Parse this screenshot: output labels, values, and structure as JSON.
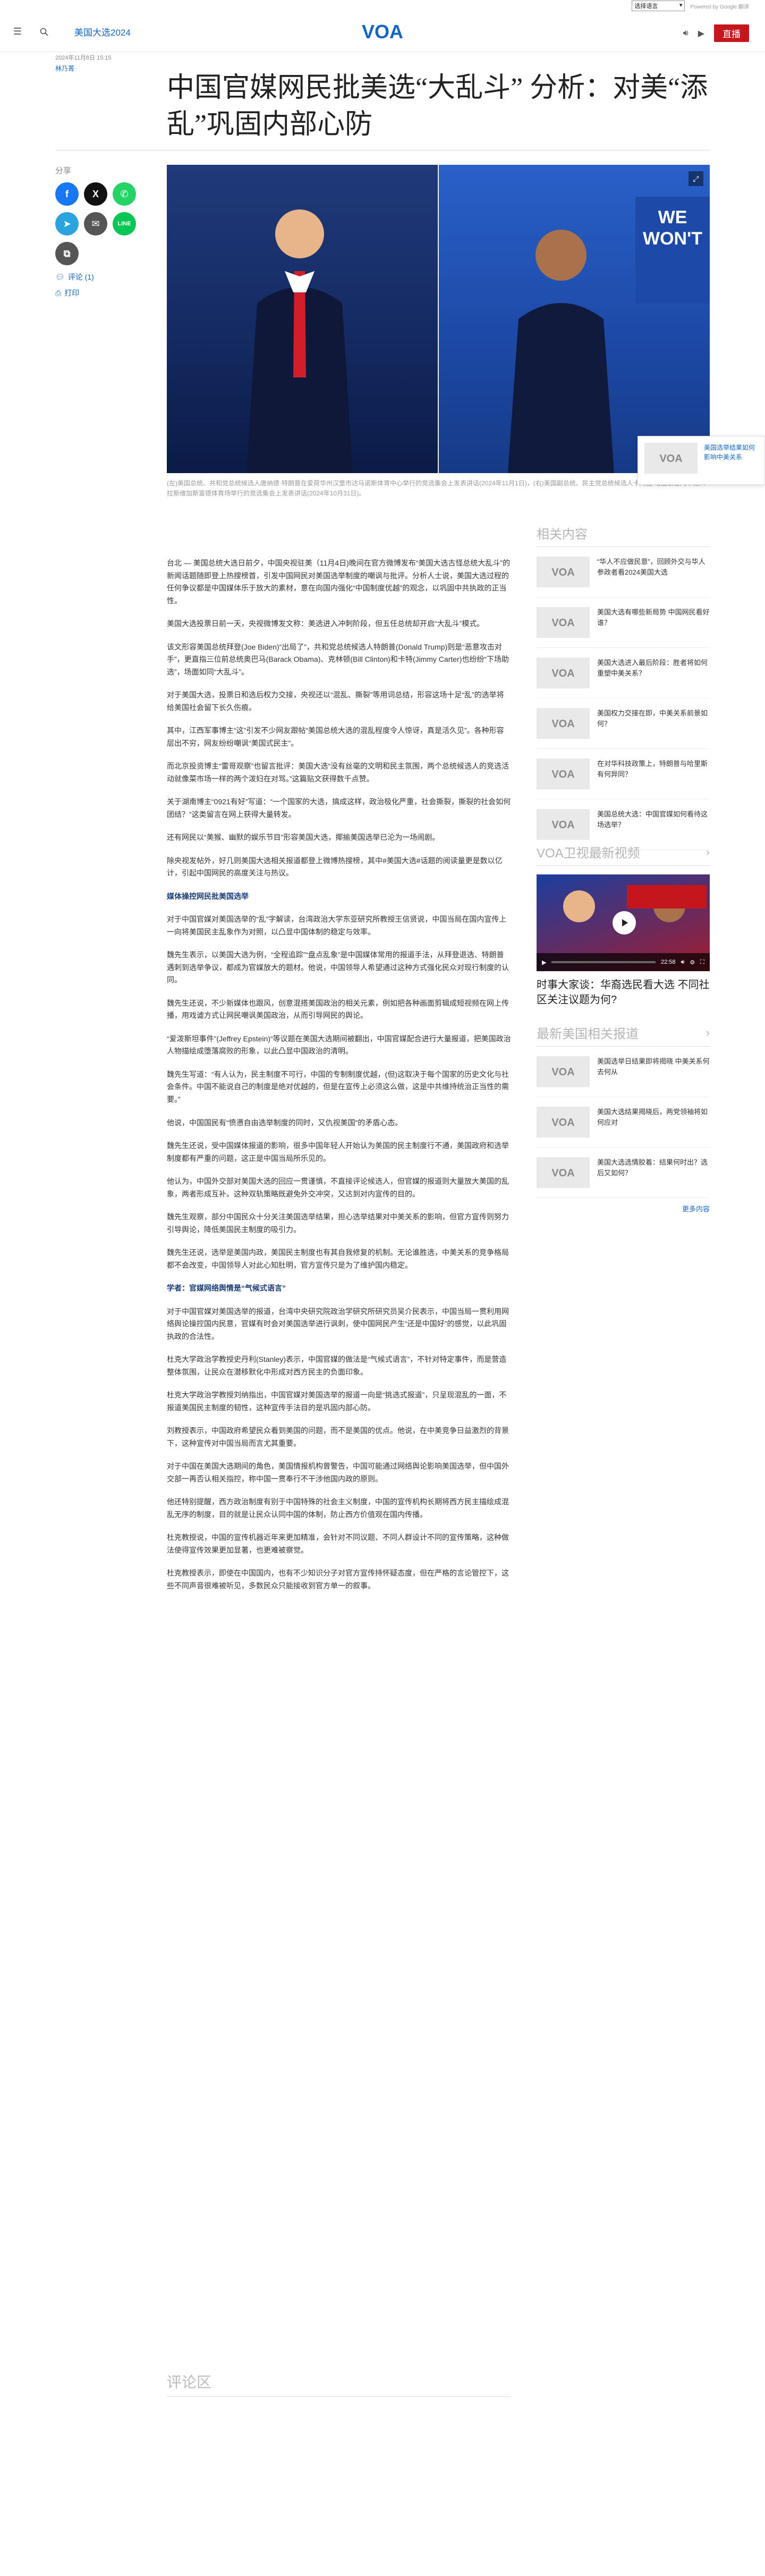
{
  "utility": {
    "lang_select": "选择语言",
    "powered_by": "Powered by Google 翻译"
  },
  "header": {
    "section": "美国大选2024",
    "live": "直播"
  },
  "brand": {
    "accent": "#1466c4",
    "live_red": "#c4161c",
    "logo_blue": "#1466c4"
  },
  "article": {
    "timestamp": "2024年11月8日 15:15",
    "author": "林乃菁",
    "title": "中国官媒网民批美选“大乱斗” 分析：对美“添乱”巩固内部心防",
    "caption": "(左)美国总统、共和党总统候选人唐纳德·特朗普在爱荷华州汉堡市达马诺斯体育中心举行的竞选集会上发表讲话(2024年11月1日)，(右)美国副总统、民主党总统候选人卡玛拉·哈里斯在内华达州拉斯维加斯富德体育场举行的竞选集会上发表讲话(2024年10月31日)。",
    "body": [
      {
        "type": "p",
        "text": "台北 — 美国总统大选日前夕，中国央视驻美（11月4日)晚间在官方微博发布“美国大选古怪总统大乱斗”的新闻话题随即登上热搜榜首，引发中国网民对美国选举制度的嘲讽与批评。分析人士说，美国大选过程的任何争议都是中国媒体乐于放大的素材，意在向国内强化“中国制度优越”的观念，以巩固中共执政的正当性。"
      },
      {
        "type": "p",
        "text": "美国大选投票日前一天，央视微博发文称：美选进入冲刺阶段，但五任总统却开启“大乱斗”模式。"
      },
      {
        "type": "p",
        "text": "该文形容美国总统拜登(Joe Biden)“出局了”，共和党总统候选人特朗普(Donald Trump)则是“恶意攻击对手”，更直指三位前总统奥巴马(Barack Obama)、克林顿(Bill Clinton)和卡特(Jimmy Carter)也纷纷“下场助选”，场面如同“大乱斗”。"
      },
      {
        "type": "p",
        "text": "对于美国大选，投票日和选后权力交接，央视还以“混乱、撕裂”等用词总结，形容这场十足“乱”的选举将给美国社会留下长久伤痕。"
      },
      {
        "type": "p",
        "text": "其中，江西军事博主“这”引发不少网友跟帖“美国总统大选的混乱程度令人惊讶，真是活久见”。各种形容层出不穷，网友纷纷嘲讽“美国式民主”。"
      },
      {
        "type": "p",
        "text": "而北京投资博主“雷哥观察”也留言批评：美国大选“没有丝毫的文明和民主氛围，两个总统候选人的竞选活动就像菜市场一样的两个泼妇在对骂。”这篇贴文获得数千点赞。"
      },
      {
        "type": "p",
        "text": "关于湖南博主“0921有好”写道：“一个国家的大选，搞成这样，政治极化严重，社会撕裂，撕裂的社会如何团结？”这类留言在网上获得大量转发。"
      },
      {
        "type": "p",
        "text": "还有网民以“美猴、幽默的娱乐节目”形容美国大选，揶揄美国选举已沦为一场闹剧。"
      },
      {
        "type": "p",
        "text": "除央视发帖外，好几则美国大选相关报道都登上微博热搜榜，其中#美国大选#话题的阅读量更是数以亿计，引起中国网民的高度关注与热议。"
      },
      {
        "type": "h3",
        "text": "媒体操控网民批美国选举"
      },
      {
        "type": "p",
        "text": "对于中国官媒对美国选举的“乱”字解读，台湾政治大学东亚研究所教授王信贤说，中国当局在国内宣传上一向将美国民主乱象作为对照，以凸显中国体制的稳定与效率。"
      },
      {
        "type": "p",
        "text": "魏先生表示，以美国大选为例，“全程追踪”“盘点乱象”是中国媒体常用的报道手法，从拜登退选、特朗普遇刺到选举争议，都成为官媒放大的题材。他说，中国领导人希望通过这种方式强化民众对现行制度的认同。"
      },
      {
        "type": "p",
        "text": "魏先生还说，不少新媒体也跟风，创意混搭美国政治的相关元素，例如把各种画面剪辑成短视频在网上传播，用戏谑方式让网民嘲讽美国政治，从而引导网民的舆论。"
      },
      {
        "type": "p",
        "text": "“爱泼斯坦事件”(Jeffrey Epstein)“等议题在美国大选期间被翻出，中国官媒配合进行大量报道，把美国政治人物描绘成堕落腐败的形象，以此凸显中国政治的清明。"
      },
      {
        "type": "p",
        "text": "魏先生写道：“有人认为，民主制度不可行，中国的专制制度优越，(但)这取决于每个国家的历史文化与社会条件。中国不能说自己的制度是绝对优越的，但是在宣传上必须这么做，这是中共维持统治正当性的需要。”"
      },
      {
        "type": "p",
        "text": "他说，中国国民有“愤懑自由选举制度的同时，又仇视美国”的矛盾心态。"
      },
      {
        "type": "p",
        "text": "魏先生还说，受中国媒体报道的影响，很多中国年轻人开始认为美国的民主制度行不通，美国政府和选举制度都有严重的问题，这正是中国当局所乐见的。"
      },
      {
        "type": "p",
        "text": "他认为，中国外交部对美国大选的回应一贯谨慎，不直接评论候选人，但官媒的报道则大量放大美国的乱象，两者形成互补。这种双轨策略既避免外交冲突，又达到对内宣传的目的。"
      },
      {
        "type": "p",
        "text": "魏先生观察，部分中国民众十分关注美国选举结果，担心选举结果对中美关系的影响，但官方宣传则努力引导舆论，降低美国民主制度的吸引力。"
      },
      {
        "type": "p",
        "text": "魏先生还说，选举是美国内政，美国民主制度也有其自我修复的机制。无论谁胜选，中美关系的竞争格局都不会改变，中国领导人对此心知肚明，官方宣传只是为了维护国内稳定。"
      },
      {
        "type": "h3",
        "text": "学者：官媒网络舆情是“气候式语言”"
      },
      {
        "type": "p",
        "text": "对于中国官媒对美国选举的报道，台湾中央研究院政治学研究所研究员吴介民表示，中国当局一贯利用网络舆论操控国内民意，官媒有时会对美国选举进行讽刺，使中国网民产生“还是中国好”的感觉，以此巩固执政的合法性。"
      },
      {
        "type": "p",
        "text": "杜克大学政治学教授史丹利(Stanley)表示，中国官媒的做法是“气候式语言”，不针对特定事件，而是营造整体氛围，让民众在潜移默化中形成对西方民主的负面印象。"
      },
      {
        "type": "p",
        "text": "杜克大学政治学教授刘纳指出，中国官媒对美国选举的报道一向是“挑选式报道”，只呈现混乱的一面，不报道美国民主制度的韧性，这种宣传手法目的是巩固内部心防。"
      },
      {
        "type": "p",
        "text": "刘教授表示，中国政府希望民众看到美国的问题，而不是美国的优点。他说，在中美竞争日益激烈的背景下，这种宣传对中国当局而言尤其重要。"
      },
      {
        "type": "p",
        "text": "对于中国在美国大选期间的角色，美国情报机构曾警告，中国可能通过网络舆论影响美国选举，但中国外交部一再否认相关指控，称中国一贯奉行不干涉他国内政的原则。"
      },
      {
        "type": "p",
        "text": "他还特别提醒，西方政治制度有别于中国特殊的社会主义制度，中国的宣传机构长期将西方民主描绘成混乱无序的制度，目的就是让民众认同中国的体制，防止西方价值观在国内传播。"
      },
      {
        "type": "p",
        "text": "杜克教授说，中国的宣传机器近年来更加精准，会针对不同议题、不同人群设计不同的宣传策略，这种做法使得宣传效果更加显著，也更难被察觉。"
      },
      {
        "type": "p",
        "text": "杜克教授表示，即使在中国国内，也有不少知识分子对官方宣传持怀疑态度，但在严格的言论管控下，这些不同声音很难被听见，多数民众只能接收到官方单一的叙事。"
      }
    ],
    "comments_title": "评论区"
  },
  "share": {
    "label": "分享",
    "comment_link": "评论 (1)",
    "print_link": "打印"
  },
  "sidebar": {
    "related_title": "相关内容",
    "related": [
      "“华人不应做民意”，回顾外交与华人参政者看2024美国大选",
      "美国大选有哪些新局势 中国网民看好谁？",
      "美国大选进入最后阶段：胜者将如何重塑中美关系？",
      "美国权力交接在即，中美关系前景如何？",
      "在对华科技政策上，特朗普与哈里斯有何异同？",
      "美国总统大选：中国官媒如何看待这场选举？"
    ],
    "video_title": "VOA卫视最新视频",
    "video_caption": "时事大家谈：华裔选民看大选 不同社区关注议题为何?",
    "video_time": "22:58",
    "video_progress": 0.0,
    "latest_title": "最新美国相关报道",
    "latest": [
      "美国选举日结果即将揭晓 中美关系何去何从",
      "美国大选结果揭晓后，两党领袖将如何应对",
      "美国大选选情胶着：结果何时出？选后又如何？"
    ],
    "more": "更多内容"
  },
  "floating": {
    "text": "美国选举结果如何影响中美关系"
  }
}
